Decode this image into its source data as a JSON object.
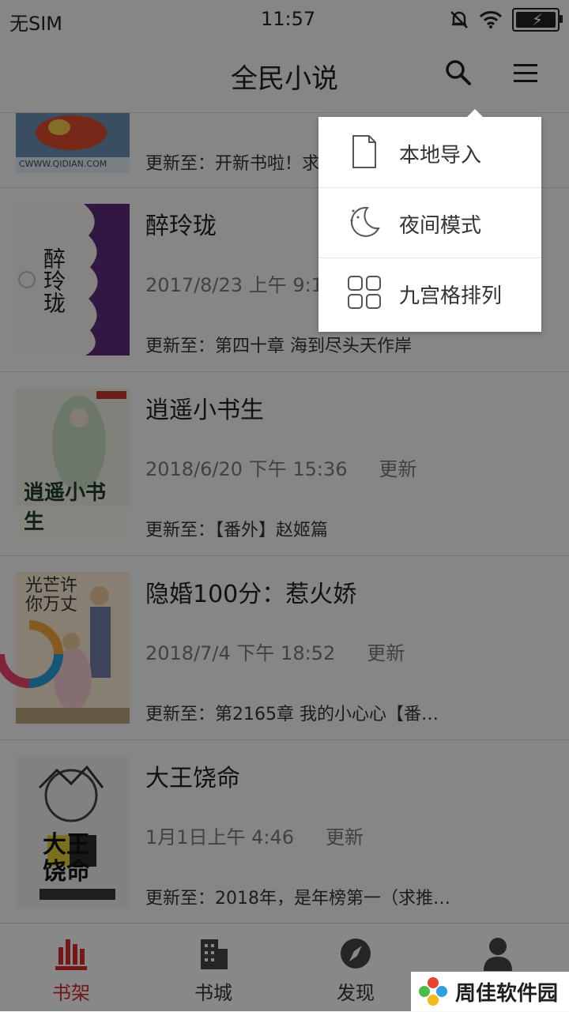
{
  "status": {
    "carrier": "无SIM",
    "time": "11:57"
  },
  "header": {
    "title": "全民小说"
  },
  "books": [
    {
      "name": "",
      "time": "",
      "latest": "更新至：开新书啦！求"
    },
    {
      "name": "醉玲珑",
      "time": "2017/8/23 上午 9:12",
      "update_label": "",
      "latest": "更新至：第四十章 海到尽头天作岸"
    },
    {
      "name": "逍遥小书生",
      "time": "2018/6/20 下午 15:36",
      "update_label": "更新",
      "latest": "更新至：【番外】赵姬篇"
    },
    {
      "name": "隐婚100分：惹火娇",
      "time": "2018/7/4 下午 18:52",
      "update_label": "更新",
      "latest": "更新至：第2165章 我的小心心【番…"
    },
    {
      "name": "大王饶命",
      "time": "1月1日上午 4:46",
      "update_label": "更新",
      "latest": "更新至：2018年，是年榜第一（求推…"
    }
  ],
  "cover_texts": {
    "cover0": "CWWW.QIDIAN.COM",
    "cover1": "醉玲珑",
    "cover2": "逍遥小书生",
    "cover3": "光芒许你万丈",
    "cover4": "大王饶命"
  },
  "tabs": [
    {
      "label": "书架"
    },
    {
      "label": "书城"
    },
    {
      "label": "发现"
    },
    {
      "label": "我的"
    }
  ],
  "menu": [
    {
      "label": "本地导入"
    },
    {
      "label": "夜间模式"
    },
    {
      "label": "九宫格排列"
    }
  ],
  "watermark": {
    "text": "周佳软件园"
  },
  "colors": {
    "accent": "#d12a2a",
    "overlay": "rgba(0,0,0,0.45)",
    "popup": "#ffffff"
  }
}
